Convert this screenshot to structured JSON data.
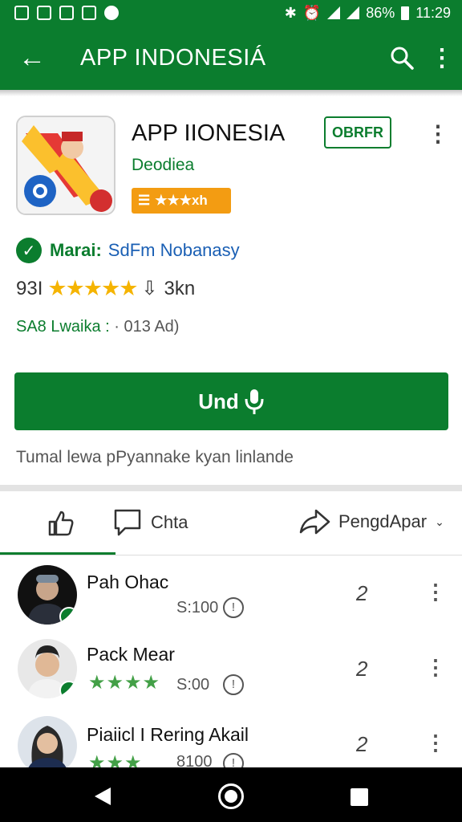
{
  "status_bar": {
    "battery": "86%",
    "time": "11:29"
  },
  "app_bar": {
    "title": "APP INDONESIÁ"
  },
  "app": {
    "name": "APP IIONESIA",
    "open_label": "OBRFR",
    "developer": "Deodiea",
    "badge": "★★★xh",
    "verified_label": "Marai:",
    "verified_value": "SdFm Nobanasy",
    "rating": "93I",
    "stars": "★★★★★",
    "downloads": "3kn",
    "size_label": "SA8 Lwaika :",
    "size_value": "· 013 Ad)",
    "install_label": "Und",
    "description": "Tumal lewa pPyannake kyan linlande"
  },
  "tabs": {
    "comment_label": "Chta",
    "share_label": "PengdApar"
  },
  "comments": [
    {
      "name": "Pah Ohac",
      "stars": "",
      "time": "S:100",
      "count": "2"
    },
    {
      "name": "Pack Mear",
      "stars": "★★★★",
      "time": "S:00",
      "count": "2"
    },
    {
      "name": "Piaiicl I Rering Akail",
      "stars": "★★★",
      "time": "8100",
      "count": "2"
    }
  ],
  "colors": {
    "primary": "#0b7d2e",
    "star": "#f5b400",
    "badge": "#f39c12",
    "link": "#1a5fb4"
  }
}
